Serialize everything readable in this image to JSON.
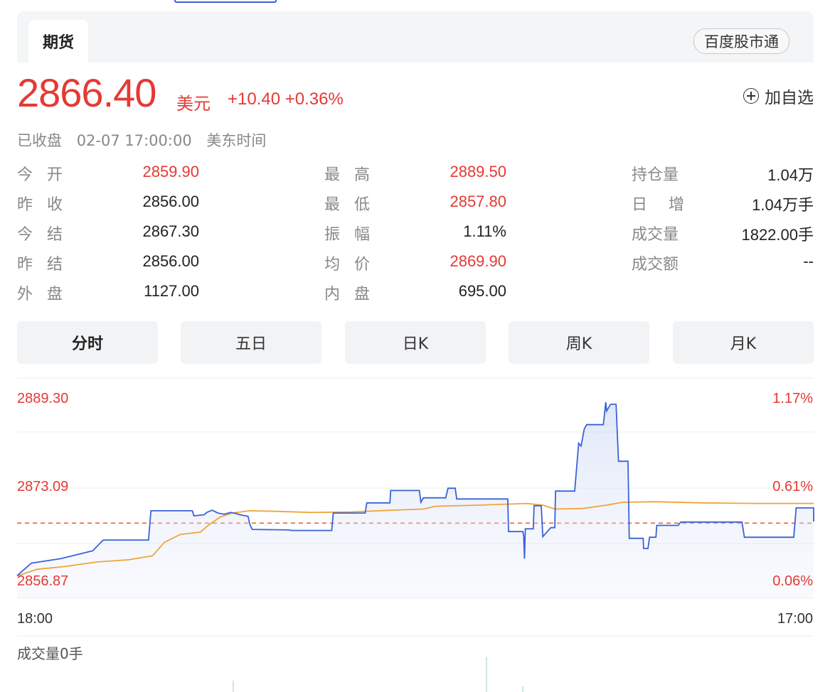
{
  "tabs": {
    "active": "期货",
    "brand_button": "百度股市通"
  },
  "quote": {
    "price": "2866.40",
    "unit": "美元",
    "change": "+10.40 +0.36%",
    "add_fav": "加自选"
  },
  "status": {
    "state": "已收盘",
    "datetime": "02-07 17:00:00",
    "timezone": "美东时间"
  },
  "stats": {
    "col1": [
      {
        "label": "今开",
        "value": "2859.90",
        "up": true
      },
      {
        "label": "昨收",
        "value": "2856.00",
        "up": false
      },
      {
        "label": "今结",
        "value": "2867.30",
        "up": false
      },
      {
        "label": "昨结",
        "value": "2856.00",
        "up": false
      },
      {
        "label": "外盘",
        "value": "1127.00",
        "up": false
      }
    ],
    "col2": [
      {
        "label": "最高",
        "value": "2889.50",
        "up": true
      },
      {
        "label": "最低",
        "value": "2857.80",
        "up": true
      },
      {
        "label": "振幅",
        "value": "1.11%",
        "up": false
      },
      {
        "label": "均价",
        "value": "2869.90",
        "up": true
      },
      {
        "label": "内盘",
        "value": "695.00",
        "up": false
      }
    ],
    "col3": [
      {
        "label": "持仓量",
        "value": "1.04万"
      },
      {
        "label": "日增",
        "value": "1.04万手"
      },
      {
        "label": "成交量",
        "value": "1822.00手"
      },
      {
        "label": "成交额",
        "value": "--"
      }
    ]
  },
  "periods": [
    "分时",
    "五日",
    "日K",
    "周K",
    "月K"
  ],
  "active_period": "分时",
  "chart_data": {
    "type": "line",
    "y_left_ticks": [
      "2889.30",
      "2873.09",
      "2856.87"
    ],
    "y_right_ticks": [
      "1.17%",
      "0.61%",
      "0.06%"
    ],
    "x_tick_labels": [
      "18:00",
      "17:00"
    ],
    "ylim": [
      2856.87,
      2889.3
    ],
    "prev_settle": 2867.3,
    "x_range": [
      0,
      1000
    ],
    "series": [
      {
        "role": "price",
        "color": "#3b63d6",
        "points": [
          [
            0,
            2858.0
          ],
          [
            2,
            2858.2
          ],
          [
            5,
            2858.6
          ],
          [
            18,
            2860.2
          ],
          [
            55,
            2861.0
          ],
          [
            95,
            2862.4
          ],
          [
            108,
            2864.3
          ],
          [
            165,
            2864.3
          ],
          [
            168,
            2869.5
          ],
          [
            220,
            2869.5
          ],
          [
            222,
            2868.6
          ],
          [
            235,
            2868.8
          ],
          [
            238,
            2869.2
          ],
          [
            245,
            2869.6
          ],
          [
            252,
            2869.1
          ],
          [
            260,
            2868.9
          ],
          [
            268,
            2869.2
          ],
          [
            275,
            2869.0
          ],
          [
            280,
            2868.8
          ],
          [
            290,
            2868.5
          ],
          [
            292,
            2867.2
          ],
          [
            295,
            2866.2
          ],
          [
            340,
            2866.1
          ],
          [
            345,
            2866.0
          ],
          [
            395,
            2866.0
          ],
          [
            397,
            2869.1
          ],
          [
            437,
            2869.1
          ],
          [
            439,
            2870.9
          ],
          [
            468,
            2870.9
          ],
          [
            469,
            2873.1
          ],
          [
            505,
            2873.1
          ],
          [
            507,
            2871.0
          ],
          [
            510,
            2871.8
          ],
          [
            538,
            2871.8
          ],
          [
            541,
            2873.5
          ],
          [
            550,
            2873.5
          ],
          [
            552,
            2871.6
          ],
          [
            616,
            2871.6
          ],
          [
            617,
            2865.8
          ],
          [
            635,
            2865.8
          ],
          [
            636,
            2865.0
          ],
          [
            637,
            2861.0
          ],
          [
            638,
            2866.3
          ],
          [
            648,
            2866.3
          ],
          [
            649,
            2870.4
          ],
          [
            658,
            2870.4
          ],
          [
            660,
            2864.9
          ],
          [
            670,
            2866.5
          ],
          [
            675,
            2866.5
          ],
          [
            676,
            2873.0
          ],
          [
            700,
            2873.0
          ],
          [
            705,
            2881.5
          ],
          [
            708,
            2881.0
          ],
          [
            712,
            2884.0
          ],
          [
            715,
            2884.8
          ],
          [
            736,
            2884.8
          ],
          [
            739,
            2888.8
          ],
          [
            740,
            2887.2
          ],
          [
            745,
            2888.4
          ],
          [
            752,
            2888.4
          ],
          [
            755,
            2878.3
          ],
          [
            767,
            2878.3
          ],
          [
            768,
            2868.8
          ],
          [
            768.5,
            2864.6
          ],
          [
            786,
            2864.6
          ],
          [
            786.5,
            2862.8
          ],
          [
            792,
            2862.8
          ],
          [
            794,
            2864.8
          ],
          [
            802,
            2864.8
          ],
          [
            803,
            2866.9
          ],
          [
            830,
            2866.9
          ],
          [
            833,
            2867.5
          ],
          [
            910,
            2867.5
          ],
          [
            913,
            2864.8
          ],
          [
            975,
            2864.8
          ],
          [
            978,
            2870.0
          ],
          [
            1000,
            2870.0
          ],
          [
            1000,
            2867.6
          ]
        ]
      },
      {
        "role": "average",
        "color": "#f0a43a",
        "points": [
          [
            0,
            2857.9
          ],
          [
            25,
            2859.1
          ],
          [
            60,
            2859.6
          ],
          [
            100,
            2860.4
          ],
          [
            140,
            2860.8
          ],
          [
            170,
            2861.5
          ],
          [
            185,
            2863.9
          ],
          [
            205,
            2865.3
          ],
          [
            230,
            2865.7
          ],
          [
            240,
            2866.9
          ],
          [
            255,
            2868.4
          ],
          [
            270,
            2869.1
          ],
          [
            292,
            2869.5
          ],
          [
            325,
            2869.4
          ],
          [
            370,
            2869.2
          ],
          [
            420,
            2869.3
          ],
          [
            470,
            2869.6
          ],
          [
            510,
            2869.8
          ],
          [
            525,
            2870.3
          ],
          [
            580,
            2870.5
          ],
          [
            640,
            2870.8
          ],
          [
            660,
            2870.5
          ],
          [
            675,
            2869.8
          ],
          [
            710,
            2869.9
          ],
          [
            740,
            2870.5
          ],
          [
            760,
            2871.0
          ],
          [
            800,
            2871.1
          ],
          [
            860,
            2870.9
          ],
          [
            930,
            2870.8
          ],
          [
            1000,
            2870.8
          ]
        ]
      }
    ],
    "volume_label": "成交量0手"
  }
}
